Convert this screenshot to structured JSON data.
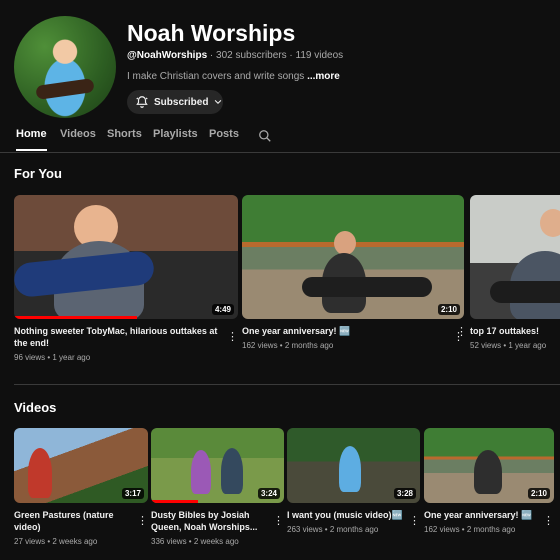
{
  "channel": {
    "name": "Noah Worships",
    "handle": "@NoahWorships",
    "stats": " · 302 subscribers · 119 videos",
    "description": "I make Christian covers and write songs ",
    "more_label": "...more",
    "subscribe_label": "Subscribed"
  },
  "tabs": [
    {
      "label": "Home"
    },
    {
      "label": "Videos"
    },
    {
      "label": "Shorts"
    },
    {
      "label": "Playlists"
    },
    {
      "label": "Posts"
    }
  ],
  "sections": {
    "for_you": {
      "title": "For You",
      "videos": [
        {
          "title": "Nothing sweeter TobyMac, hilarious outtakes at the end!",
          "views": "96 views",
          "age": "1 year ago",
          "duration": "4:49",
          "progress_percent": 55
        },
        {
          "title": "One year anniversary! 🆕",
          "views": "162 views",
          "age": "2 months ago",
          "duration": "2:10",
          "progress_percent": 0
        },
        {
          "title": "top 17 outtakes!",
          "views": "52 views",
          "age": "1 year ago",
          "duration": "",
          "progress_percent": 0
        }
      ]
    },
    "videos": {
      "title": "Videos",
      "videos": [
        {
          "title": "Green Pastures (nature video)",
          "views": "27 views",
          "age": "2 weeks ago",
          "duration": "3:17",
          "progress_percent": 0
        },
        {
          "title": "Dusty Bibles by Josiah Queen, Noah Worships...",
          "views": "336 views",
          "age": "2 weeks ago",
          "duration": "3:24",
          "progress_percent": 35
        },
        {
          "title": "I want you (music video)🆕",
          "views": "263 views",
          "age": "2 months ago",
          "duration": "3:28",
          "progress_percent": 0
        },
        {
          "title": "One year anniversary! 🆕",
          "views": "162 views",
          "age": "2 months ago",
          "duration": "2:10",
          "progress_percent": 0
        }
      ]
    }
  },
  "colors": {
    "background": "#0f0f0f",
    "progress": "#ff0000",
    "chip": "#272727",
    "muted_text": "#aaaaaa"
  },
  "icons": {
    "bell": "bell-icon",
    "chevron": "chevron-down-icon",
    "search": "search-icon",
    "more": "more-vert-icon"
  }
}
